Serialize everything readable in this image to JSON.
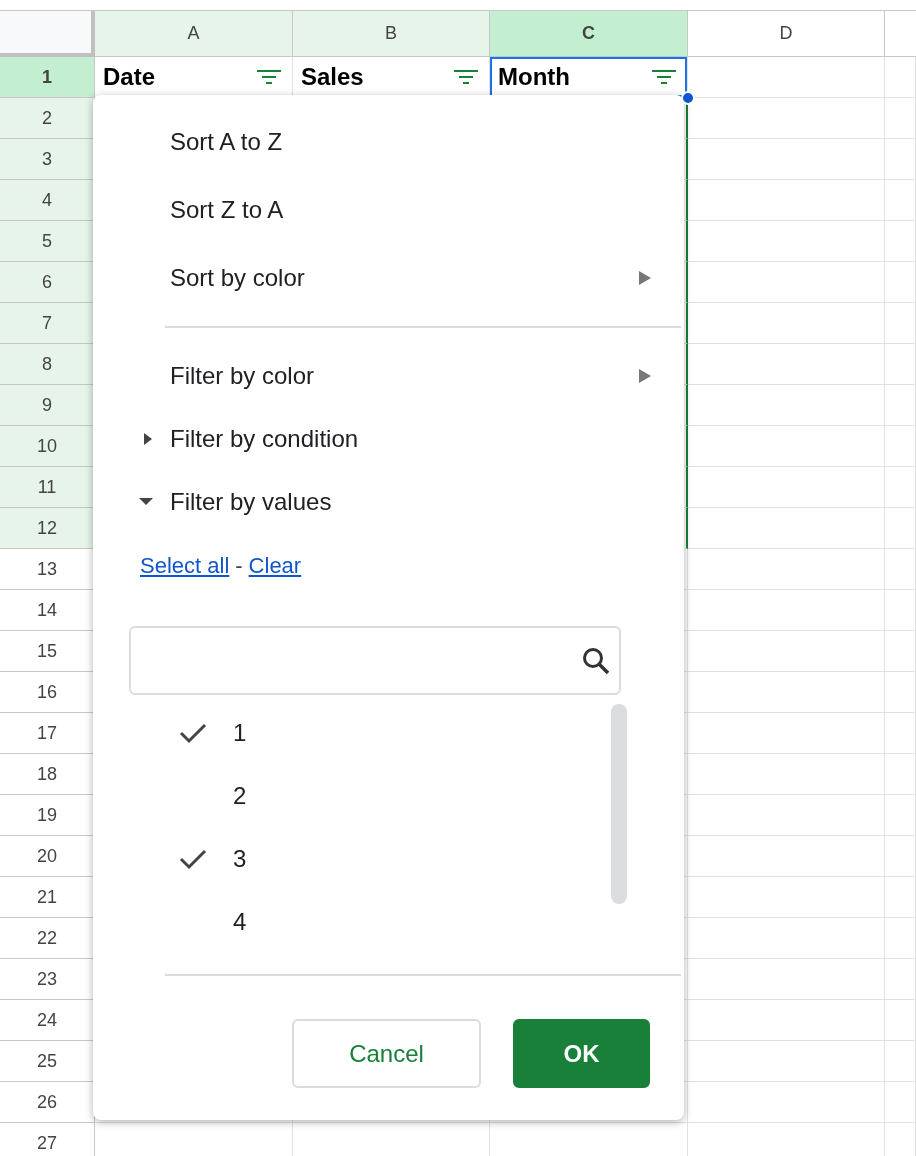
{
  "columns": [
    {
      "label": "A",
      "selected": false,
      "in_filter": true
    },
    {
      "label": "B",
      "selected": false,
      "in_filter": true
    },
    {
      "label": "C",
      "selected": true,
      "in_filter": true
    },
    {
      "label": "D",
      "selected": false,
      "in_filter": false
    }
  ],
  "header_cells": [
    {
      "text": "Date",
      "filter": true,
      "active": false
    },
    {
      "text": "Sales",
      "filter": true,
      "active": false
    },
    {
      "text": "Month",
      "filter": true,
      "active": true
    }
  ],
  "rows": [
    {
      "label": "1",
      "selected": true,
      "in_filter": true
    },
    {
      "label": "2",
      "selected": false,
      "in_filter": true
    },
    {
      "label": "3",
      "selected": false,
      "in_filter": true
    },
    {
      "label": "4",
      "selected": false,
      "in_filter": true
    },
    {
      "label": "5",
      "selected": false,
      "in_filter": true
    },
    {
      "label": "6",
      "selected": false,
      "in_filter": true
    },
    {
      "label": "7",
      "selected": false,
      "in_filter": true
    },
    {
      "label": "8",
      "selected": false,
      "in_filter": true
    },
    {
      "label": "9",
      "selected": false,
      "in_filter": true
    },
    {
      "label": "10",
      "selected": false,
      "in_filter": true
    },
    {
      "label": "11",
      "selected": false,
      "in_filter": true
    },
    {
      "label": "12",
      "selected": false,
      "in_filter": true
    },
    {
      "label": "13",
      "selected": false,
      "in_filter": false
    },
    {
      "label": "14",
      "selected": false,
      "in_filter": false
    },
    {
      "label": "15",
      "selected": false,
      "in_filter": false
    },
    {
      "label": "16",
      "selected": false,
      "in_filter": false
    },
    {
      "label": "17",
      "selected": false,
      "in_filter": false
    },
    {
      "label": "18",
      "selected": false,
      "in_filter": false
    },
    {
      "label": "19",
      "selected": false,
      "in_filter": false
    },
    {
      "label": "20",
      "selected": false,
      "in_filter": false
    },
    {
      "label": "21",
      "selected": false,
      "in_filter": false
    },
    {
      "label": "22",
      "selected": false,
      "in_filter": false
    },
    {
      "label": "23",
      "selected": false,
      "in_filter": false
    },
    {
      "label": "24",
      "selected": false,
      "in_filter": false
    },
    {
      "label": "25",
      "selected": false,
      "in_filter": false
    },
    {
      "label": "26",
      "selected": false,
      "in_filter": false
    },
    {
      "label": "27",
      "selected": false,
      "in_filter": false
    }
  ],
  "filter_menu": {
    "sort_items": [
      {
        "kind": "item",
        "label": "Sort A to Z"
      },
      {
        "kind": "item",
        "label": "Sort Z to A"
      },
      {
        "kind": "submenu",
        "label": "Sort by color"
      }
    ],
    "filter_items": [
      {
        "kind": "submenu",
        "label": "Filter by color"
      },
      {
        "kind": "section",
        "label": "Filter by condition",
        "expanded": false
      },
      {
        "kind": "section",
        "label": "Filter by values",
        "expanded": true
      }
    ],
    "select_all": "Select all",
    "separator": "-",
    "clear": "Clear",
    "values": [
      {
        "label": "1",
        "checked": true
      },
      {
        "label": "2",
        "checked": false
      },
      {
        "label": "3",
        "checked": true
      },
      {
        "label": "4",
        "checked": false
      }
    ],
    "buttons": [
      {
        "kind": "secondary",
        "label": "Cancel"
      },
      {
        "kind": "primary",
        "label": "OK"
      }
    ]
  }
}
